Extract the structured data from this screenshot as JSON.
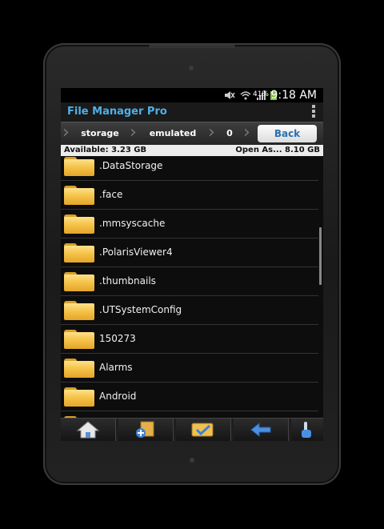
{
  "status_bar": {
    "battery": "41%",
    "time": "9:18 AM",
    "icons": [
      "mute-icon",
      "wifi-icon",
      "signal-icon",
      "battery-charging-icon"
    ]
  },
  "app": {
    "title": "File Manager Pro"
  },
  "breadcrumbs": {
    "items": [
      "storage",
      "emulated",
      "0"
    ],
    "back_label": "Back"
  },
  "storage_info": {
    "available": "Available: 3.23 GB",
    "right": "Open As... 8.10 GB"
  },
  "files": [
    {
      "name": ".DataStorage"
    },
    {
      "name": ".face"
    },
    {
      "name": ".mmsyscache"
    },
    {
      "name": ".PolarisViewer4"
    },
    {
      "name": ".thumbnails"
    },
    {
      "name": ".UTSystemConfig"
    },
    {
      "name": "150273"
    },
    {
      "name": "Alarms"
    },
    {
      "name": "Android"
    },
    {
      "name": ""
    }
  ],
  "toolbar": {
    "buttons": [
      "home-icon",
      "new-folder-icon",
      "select-folder-icon",
      "back-arrow-icon",
      "touch-icon"
    ]
  },
  "colors": {
    "title_accent": "#4fb0e8",
    "folder": "#f5c44a"
  }
}
